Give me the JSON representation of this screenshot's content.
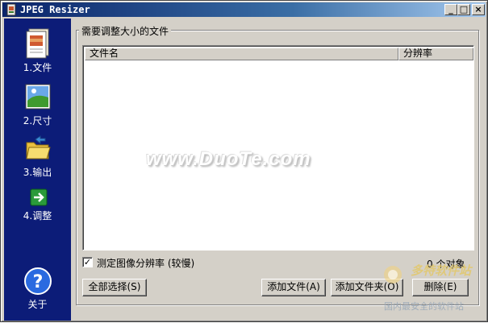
{
  "window": {
    "title": "JPEG Resizer",
    "controls": {
      "minimize": "_",
      "maximize": "□",
      "close": "×"
    }
  },
  "sidebar": {
    "items": [
      {
        "label": "1.文件",
        "icon": "file-icon"
      },
      {
        "label": "2.尺寸",
        "icon": "picture-icon"
      },
      {
        "label": "3.输出",
        "icon": "folder-icon"
      },
      {
        "label": "4.调整",
        "icon": "go-arrow-icon"
      }
    ],
    "about": {
      "label": "关于",
      "icon": "help-icon"
    }
  },
  "main": {
    "group_title": "需要调整大小的文件",
    "table": {
      "columns": [
        "文件名",
        "分辨率"
      ],
      "rows": []
    },
    "detect_resolution": {
      "label": "测定图像分辨率 (较慢)",
      "checked": true,
      "mark": "✓"
    },
    "object_count": "0 个对象",
    "buttons": {
      "select_all": "全部选择(S)",
      "add_file": "添加文件(A)",
      "add_folder": "添加文件夹(O)",
      "delete": "删除(E)"
    }
  },
  "watermark": {
    "center": "www.DuoTe.com",
    "corner_brand": "多特软件站",
    "corner_slogan": "国内最安全的软件站"
  },
  "colors": {
    "sidebar_bg": "#0c1c78",
    "titlebar": "#0a246a",
    "dialog_bg": "#d4d0c8"
  }
}
